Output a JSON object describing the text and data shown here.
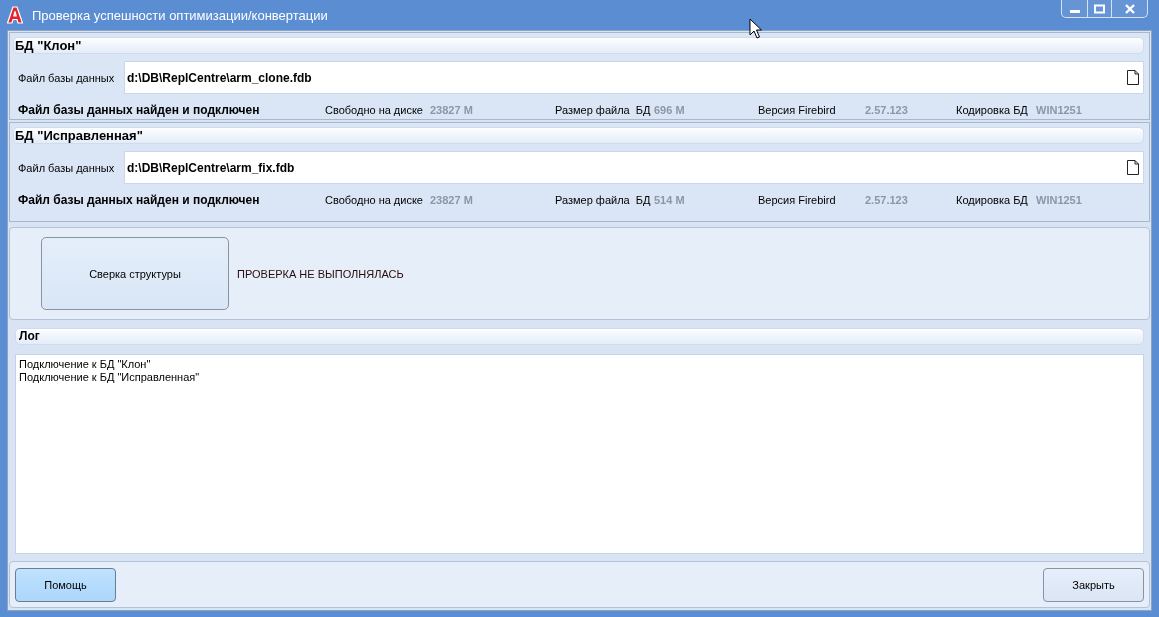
{
  "window": {
    "title": "Проверка успешности оптимизации/конвертации"
  },
  "databases": [
    {
      "title": "БД \"Клон\"",
      "file_label": "Файл базы данных",
      "file_path": "d:\\DB\\ReplCentre\\arm_clone.fdb",
      "status": "Файл базы данных найден и подключен",
      "info": [
        {
          "label": "Свободно на диске",
          "value": "23827 M"
        },
        {
          "label": "Размер файла  БД",
          "value": "696 M"
        },
        {
          "label": "Версия Firebird",
          "value": "2.57.123"
        },
        {
          "label": "Кодировка БД",
          "value": "WIN1251"
        }
      ]
    },
    {
      "title": "БД \"Исправленная\"",
      "file_label": "Файл базы данных",
      "file_path": "d:\\DB\\ReplCentre\\arm_fix.fdb",
      "status": "Файл базы данных найден и подключен",
      "info": [
        {
          "label": "Свободно на диске",
          "value": "23827 M"
        },
        {
          "label": "Размер файла  БД",
          "value": "514 M"
        },
        {
          "label": "Версия Firebird",
          "value": "2.57.123"
        },
        {
          "label": "Кодировка БД",
          "value": "WIN1251"
        }
      ]
    }
  ],
  "structure_check": {
    "button": "Сверка структуры",
    "result": "ПРОВЕРКА НЕ ВЫПОЛНЯЛАСЬ"
  },
  "log": {
    "title": "Лог",
    "lines": [
      "Подключение к БД \"Клон\"",
      "Подключение к БД \"Исправленная\""
    ]
  },
  "footer": {
    "buttons": [
      {
        "label": "Помощь",
        "focused": true
      },
      {
        "label": "Закрыть",
        "focused": false
      }
    ]
  }
}
